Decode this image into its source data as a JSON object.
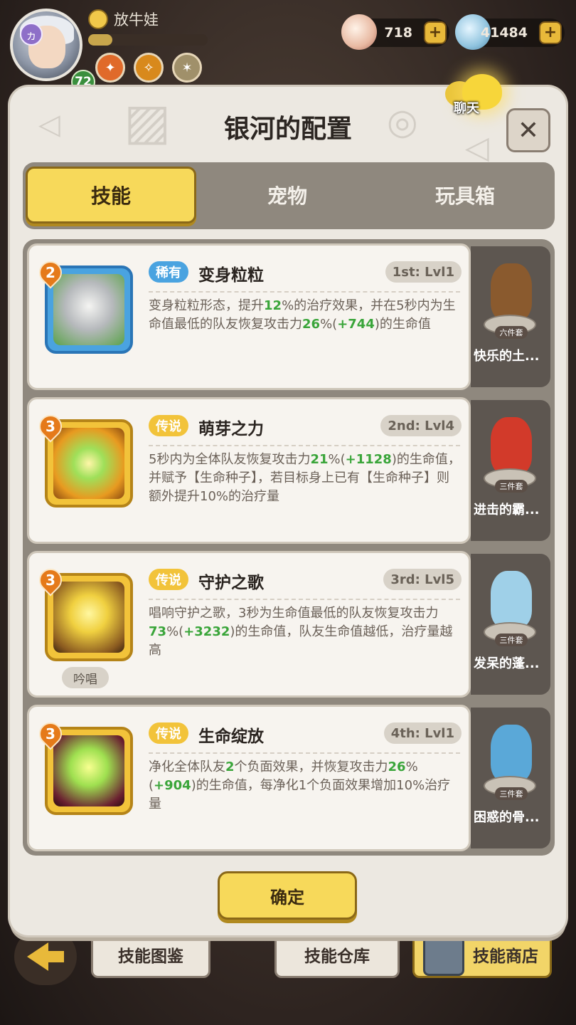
{
  "player": {
    "name": "放牛娃",
    "level": "72",
    "rune": "ヵ",
    "xp_fraction": 0.2
  },
  "currencies": [
    {
      "icon": "shell-icon",
      "value": "718"
    },
    {
      "icon": "gem-icon",
      "value": "41484"
    }
  ],
  "modal": {
    "title": "银河的配置",
    "chat_label": "聊天",
    "close_glyph": "✕",
    "tabs": [
      "技能",
      "宠物",
      "玩具箱"
    ],
    "active_tab": 0,
    "confirm_label": "确定"
  },
  "skills": [
    {
      "stars": "2",
      "rarity": "稀有",
      "name": "变身粒粒",
      "level": "1st: Lvl1",
      "desc": [
        {
          "t": "变身粒粒形态，提升"
        },
        {
          "t": "12",
          "hl": true
        },
        {
          "t": "%的治疗效果，并在5秒内为生命值最低的队友恢复攻击力"
        },
        {
          "t": "26",
          "hl": true
        },
        {
          "t": "%("
        },
        {
          "t": "+744",
          "hl": true
        },
        {
          "t": ")的生命值"
        }
      ],
      "toy_name": "快乐的土...",
      "toy_badge": "六件套",
      "toy_color": "#8a5a2e"
    },
    {
      "stars": "3",
      "rarity": "传说",
      "name": "萌芽之力",
      "level": "2nd: Lvl4",
      "desc": [
        {
          "t": "5秒内为全体队友恢复攻击力"
        },
        {
          "t": "21",
          "hl": true
        },
        {
          "t": "%("
        },
        {
          "t": "+1128",
          "hl": true
        },
        {
          "t": ")的生命值，并赋予【生命种子】，若目标身上已有【生命种子】则额外提升10%的治疗量"
        }
      ],
      "toy_name": "进击的霸...",
      "toy_badge": "三件套",
      "toy_color": "#d23a2a"
    },
    {
      "stars": "3",
      "rarity": "传说",
      "name": "守护之歌",
      "level": "3rd: Lvl5",
      "chant": "吟唱",
      "desc": [
        {
          "t": "唱响守护之歌，3秒为生命值最低的队友恢复攻击力"
        },
        {
          "t": "73",
          "hl": true
        },
        {
          "t": "%("
        },
        {
          "t": "+3232",
          "hl": true
        },
        {
          "t": ")的生命值，队友生命值越低，治疗量越高"
        }
      ],
      "toy_name": "发呆的蓬...",
      "toy_badge": "三件套",
      "toy_color": "#9fd0e8"
    },
    {
      "stars": "3",
      "rarity": "传说",
      "name": "生命绽放",
      "level": "4th: Lvl1",
      "desc": [
        {
          "t": "净化全体队友"
        },
        {
          "t": "2",
          "hl": true
        },
        {
          "t": "个负面效果，并恢复攻击力"
        },
        {
          "t": "26",
          "hl": true
        },
        {
          "t": "%("
        },
        {
          "t": "+904",
          "hl": true
        },
        {
          "t": ")的生命值，每净化1个负面效果增加10%治疗量"
        }
      ],
      "toy_name": "困惑的骨...",
      "toy_badge": "三件套",
      "toy_color": "#5aa8d8"
    }
  ],
  "bottom_bar": {
    "btn1": "技能图鉴",
    "btn2": "技能仓库",
    "btn3": "技能商店"
  },
  "colors": {
    "accent_yellow": "#f7d95a",
    "rare_blue": "#4aa3e0",
    "legend_gold": "#f2c33a",
    "highlight_green": "#3aa53a"
  }
}
